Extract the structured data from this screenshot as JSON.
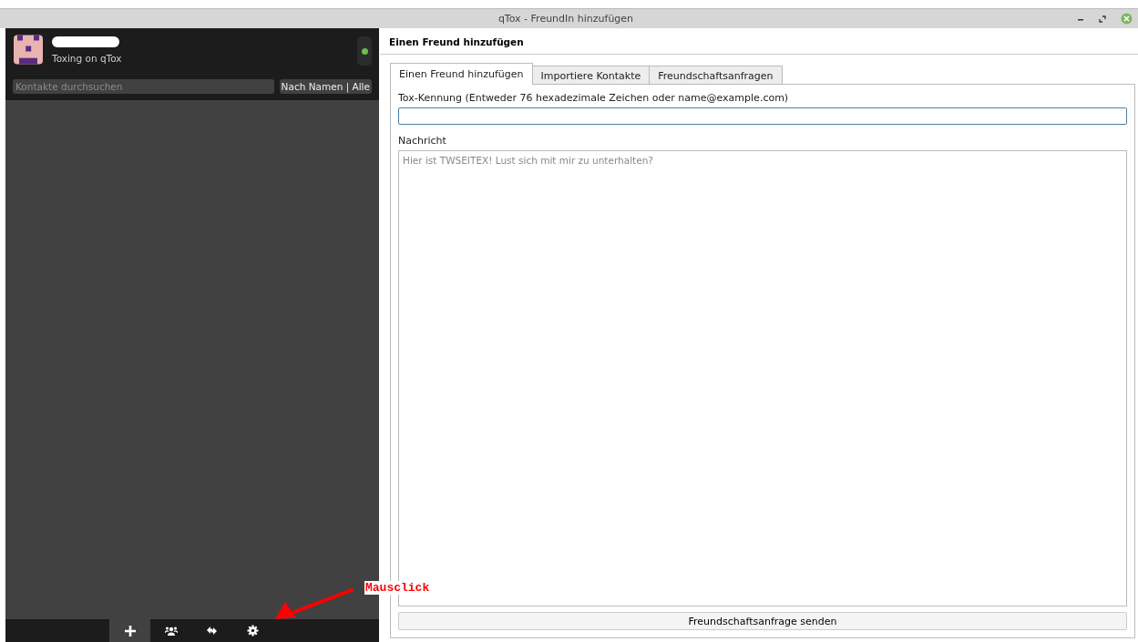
{
  "window": {
    "title": "qTox - FreundIn hinzufügen"
  },
  "profile": {
    "status_message": "Toxing on qTox",
    "online": true
  },
  "contacts": {
    "search": {
      "placeholder": "Kontakte durchsuchen"
    },
    "filter_button": "Nach Namen | Alle"
  },
  "bottom_bar": [
    {
      "kind": "add",
      "selected": true
    },
    {
      "kind": "group",
      "selected": false
    },
    {
      "kind": "transfer",
      "selected": false
    },
    {
      "kind": "settings",
      "selected": false
    }
  ],
  "page": {
    "heading": "Einen Freund hinzufügen",
    "tabs": [
      {
        "label": "Einen Freund hinzufügen",
        "selected": true
      },
      {
        "label": "Importiere Kontakte",
        "selected": false
      },
      {
        "label": "Freundschaftsanfragen",
        "selected": false
      }
    ],
    "id_label": "Tox-Kennung (Entweder 76 hexadezimale Zeichen oder name@example.com)",
    "message_label": "Nachricht",
    "message_placeholder": "Hier ist TWSEITEX! Lust sich mit mir zu unterhalten?",
    "send_button": "Freundschaftsanfrage senden"
  },
  "annotation": {
    "text": "Mausclick"
  }
}
